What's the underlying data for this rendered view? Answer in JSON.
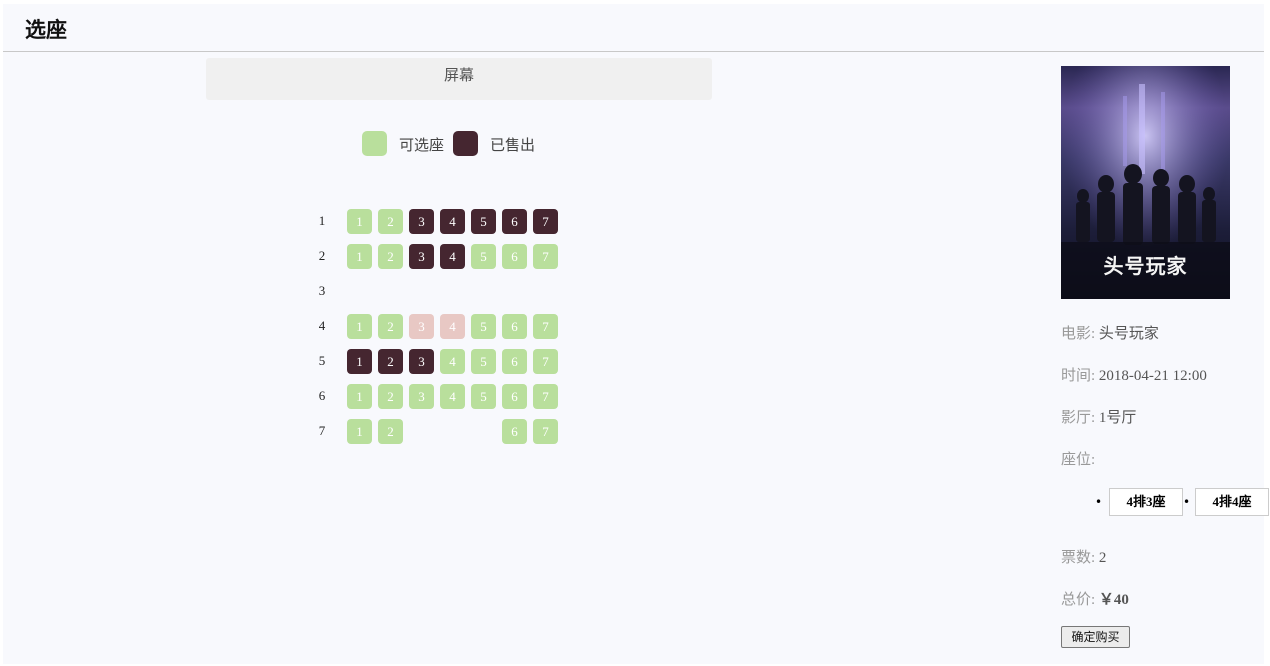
{
  "header": {
    "title": "选座"
  },
  "screen": {
    "label": "屏幕"
  },
  "legend": {
    "available_label": "可选座",
    "sold_label": "已售出",
    "available_color": "#b9df9c",
    "sold_color": "#452630",
    "selected_color": "#e8c8c4"
  },
  "seat_rows": [
    {
      "row": "1",
      "seats": [
        {
          "num": "1",
          "status": "available"
        },
        {
          "num": "2",
          "status": "available"
        },
        {
          "num": "3",
          "status": "sold"
        },
        {
          "num": "4",
          "status": "sold"
        },
        {
          "num": "5",
          "status": "sold"
        },
        {
          "num": "6",
          "status": "sold"
        },
        {
          "num": "7",
          "status": "sold"
        }
      ]
    },
    {
      "row": "2",
      "seats": [
        {
          "num": "1",
          "status": "available"
        },
        {
          "num": "2",
          "status": "available"
        },
        {
          "num": "3",
          "status": "sold"
        },
        {
          "num": "4",
          "status": "sold"
        },
        {
          "num": "5",
          "status": "available"
        },
        {
          "num": "6",
          "status": "available"
        },
        {
          "num": "7",
          "status": "available"
        }
      ]
    },
    {
      "row": "3",
      "seats": []
    },
    {
      "row": "4",
      "seats": [
        {
          "num": "1",
          "status": "available"
        },
        {
          "num": "2",
          "status": "available"
        },
        {
          "num": "3",
          "status": "selected"
        },
        {
          "num": "4",
          "status": "selected"
        },
        {
          "num": "5",
          "status": "available"
        },
        {
          "num": "6",
          "status": "available"
        },
        {
          "num": "7",
          "status": "available"
        }
      ]
    },
    {
      "row": "5",
      "seats": [
        {
          "num": "1",
          "status": "sold"
        },
        {
          "num": "2",
          "status": "sold"
        },
        {
          "num": "3",
          "status": "sold"
        },
        {
          "num": "4",
          "status": "available"
        },
        {
          "num": "5",
          "status": "available"
        },
        {
          "num": "6",
          "status": "available"
        },
        {
          "num": "7",
          "status": "available"
        }
      ]
    },
    {
      "row": "6",
      "seats": [
        {
          "num": "1",
          "status": "available"
        },
        {
          "num": "2",
          "status": "available"
        },
        {
          "num": "3",
          "status": "available"
        },
        {
          "num": "4",
          "status": "available"
        },
        {
          "num": "5",
          "status": "available"
        },
        {
          "num": "6",
          "status": "available"
        },
        {
          "num": "7",
          "status": "available"
        }
      ]
    },
    {
      "row": "7",
      "seats": [
        {
          "num": "1",
          "status": "available"
        },
        {
          "num": "2",
          "status": "available"
        },
        {
          "num": "6",
          "status": "available"
        },
        {
          "num": "7",
          "status": "available"
        }
      ]
    }
  ],
  "poster": {
    "text": "头号玩家"
  },
  "info": {
    "movie_label": "电影:",
    "movie_value": "头号玩家",
    "time_label": "时间:",
    "time_value": "2018-04-21 12:00",
    "hall_label": "影厅:",
    "hall_value": "1号厅",
    "seats_label": "座位:",
    "selected_seats": [
      "4排3座",
      "4排4座"
    ],
    "count_label": "票数:",
    "count_value": "2",
    "price_label": "总价:",
    "price_value": "￥40"
  },
  "confirm_label": "确定购买"
}
